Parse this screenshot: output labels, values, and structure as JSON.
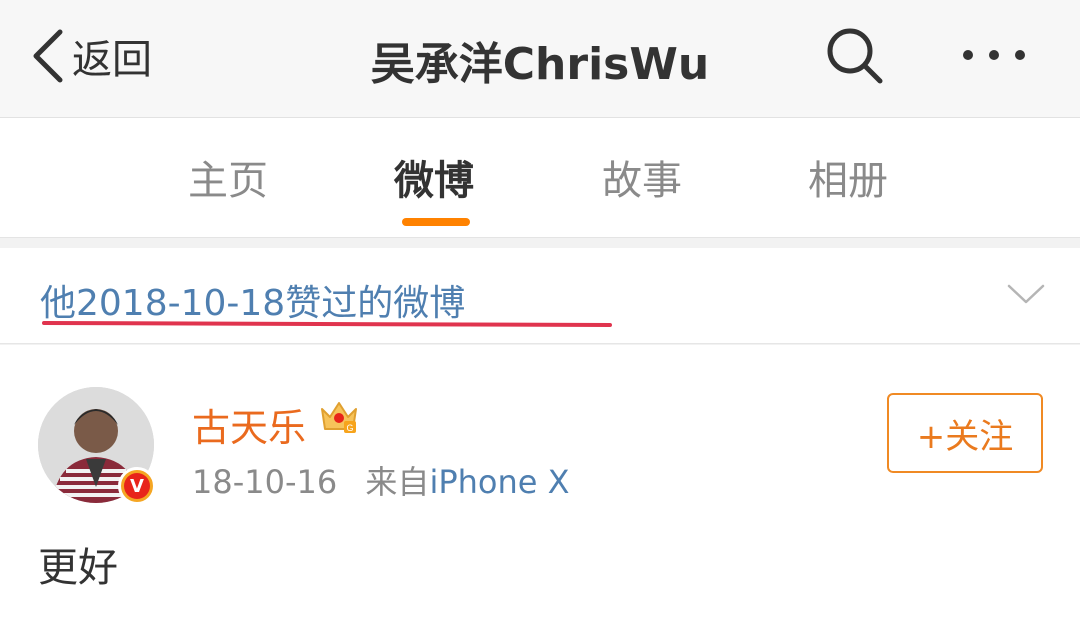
{
  "nav": {
    "back_label": "返回",
    "title": "吴承洋ChrisWu"
  },
  "tabs": [
    {
      "label": "主页",
      "active": false
    },
    {
      "label": "微博",
      "active": true
    },
    {
      "label": "故事",
      "active": false
    },
    {
      "label": "相册",
      "active": false
    }
  ],
  "filter": {
    "label": "他2018-10-18赞过的微博"
  },
  "post": {
    "author": "古天乐",
    "date": "18-10-16",
    "source_prefix": "来自",
    "device": "iPhone X",
    "follow_label": "+关注",
    "text": "更好",
    "verified_badge": "V"
  },
  "colors": {
    "accent": "#ff8200",
    "link": "#4f7fb0",
    "author": "#ea6a1e",
    "highlight_mark": "#e0344e"
  }
}
